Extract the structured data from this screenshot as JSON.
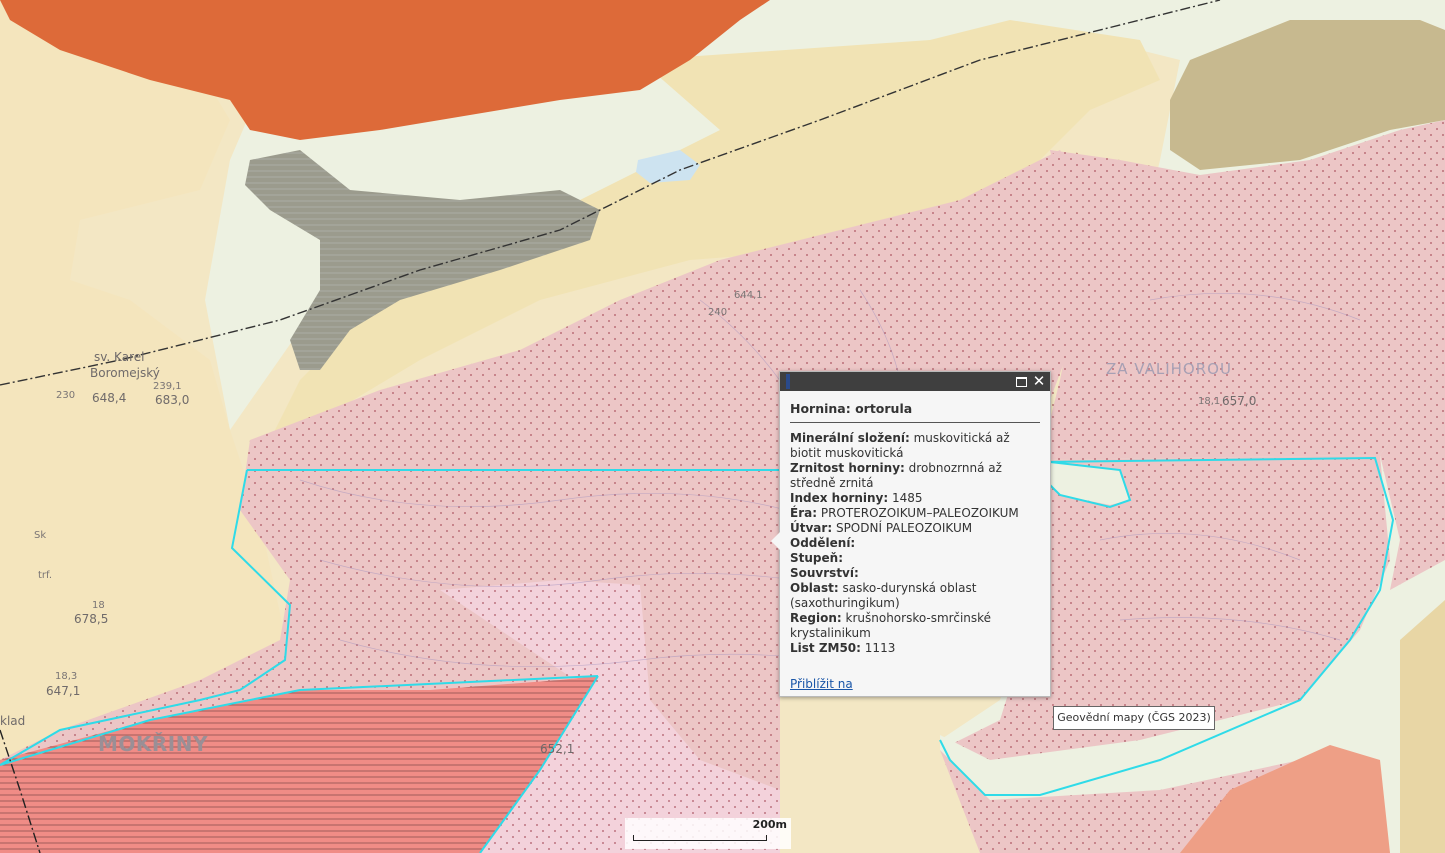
{
  "map": {
    "labels": {
      "mokriny": "MOKŘINY",
      "za_valihorou": "ZA VALIHOROU",
      "karel": "sv. Karel",
      "boromejsky": "Boromejský",
      "h6831": "683,0",
      "h2391": "239,1",
      "h230": "230",
      "h6484": "648,4",
      "h6441": "644,1",
      "h240": "240",
      "h6785": "678,5",
      "h18a": "18",
      "h6471": "647,1",
      "h183": "18,3",
      "h6570": "657,0",
      "h18b": "18,1",
      "h6521": "652,1",
      "hklad": "klad",
      "hzk": "Sk",
      "htrf": "trf."
    },
    "colors": {
      "cream": "#f3e7c4",
      "sand": "#f0e1b2",
      "pink": "#ecc6c6",
      "light_pink": "#f3d2db",
      "orange": "#dd6a39",
      "gray": "#9b9b8d",
      "olive": "#c7b98f",
      "salmon": "#f08c86",
      "greenish": "#edf1e1",
      "boundary": "#2fdbe8"
    }
  },
  "popup": {
    "title": "Hornina: ortorula",
    "attributes": [
      {
        "label": "Minerální složení:",
        "value": "muskovitická až biotit muskovitická"
      },
      {
        "label": "Zrnitost horniny:",
        "value": "drobnozrnná až středně zrnitá"
      },
      {
        "label": "Index horniny:",
        "value": "1485"
      },
      {
        "label": "Éra:",
        "value": "PROTEROZOIKUM–PALEOZOIKUM"
      },
      {
        "label": "Útvar:",
        "value": "SPODNÍ PALEOZOIKUM"
      },
      {
        "label": "Oddělení:",
        "value": ""
      },
      {
        "label": "Stupeň:",
        "value": ""
      },
      {
        "label": "Souvrství:",
        "value": ""
      },
      {
        "label": "Oblast:",
        "value": "sasko-durynská oblast (saxothuringikum)"
      },
      {
        "label": "Region:",
        "value": "krušnohorsko-smrčinské krystalinikum"
      },
      {
        "label": "List ZM50:",
        "value": "1113"
      }
    ],
    "zoom_link": "Přiblížit na",
    "maximize_icon": "maximize-icon",
    "close_icon": "close-icon"
  },
  "attribution": "Geovědní mapy (ČGS 2023)",
  "scalebar": {
    "label": "200m"
  }
}
